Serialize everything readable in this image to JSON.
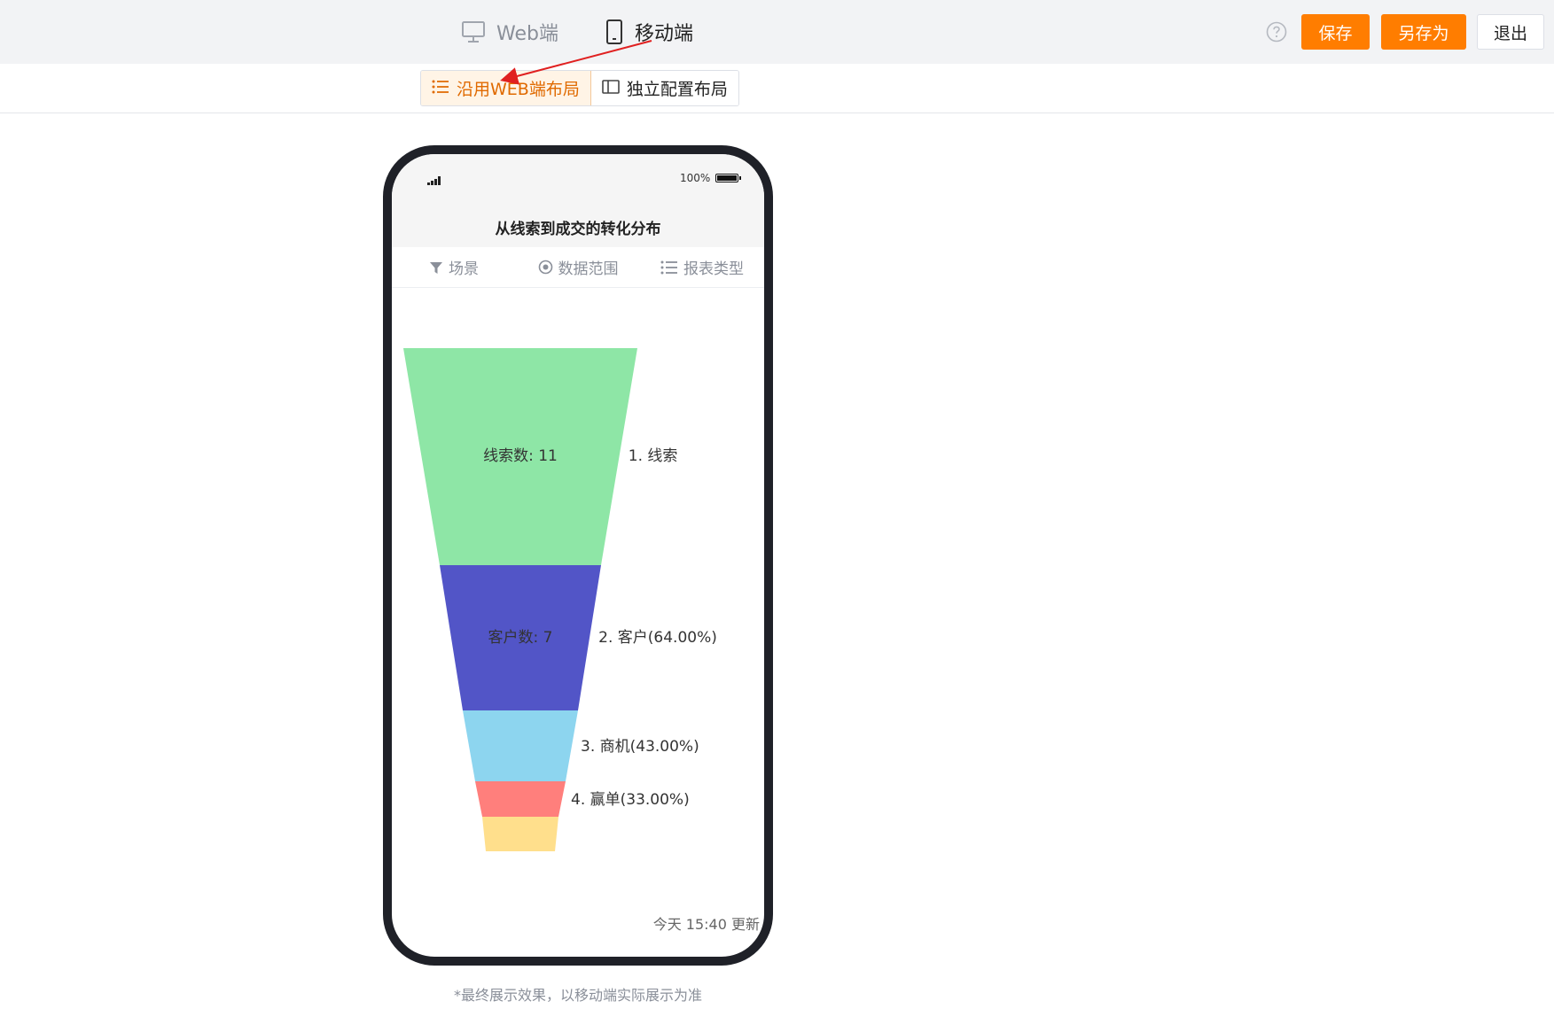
{
  "header": {
    "platform_tabs": [
      {
        "label": "Web端",
        "icon": "desktop-monitor-icon",
        "active": false
      },
      {
        "label": "移动端",
        "icon": "mobile-phone-icon",
        "active": true
      }
    ],
    "help_icon": "question-circle-icon",
    "buttons": {
      "save": "保存",
      "save_as": "另存为",
      "exit": "退出"
    },
    "accent_color": "#ff7d00"
  },
  "layout_toggle": {
    "options": [
      {
        "label": "沿用WEB端布局",
        "icon": "list-icon",
        "active": true
      },
      {
        "label": "独立配置布局",
        "icon": "panel-layout-icon",
        "active": false
      }
    ]
  },
  "phone": {
    "status": {
      "battery_percent": "100%"
    },
    "report_title": "从线索到成交的转化分布",
    "filters": [
      {
        "label": "场景",
        "icon": "filter-funnel-icon"
      },
      {
        "label": "数据范围",
        "icon": "target-circle-icon"
      },
      {
        "label": "报表类型",
        "icon": "list-icon"
      }
    ],
    "updated_text": "今天 15:40 更新"
  },
  "chart_data": {
    "type": "funnel",
    "title": "从线索到成交的转化分布",
    "stages": [
      {
        "name": "线索",
        "value": 11,
        "inside_label": "线索数: 11",
        "side_label": "1. 线索",
        "color": "#8ee6a6"
      },
      {
        "name": "客户",
        "value": 7,
        "percent": 64.0,
        "inside_label": "客户数: 7",
        "side_label": "2. 客户(64.00%)",
        "color": "#5255c7"
      },
      {
        "name": "商机",
        "percent": 43.0,
        "inside_label": "",
        "side_label": "3. 商机(43.00%)",
        "color": "#8dd5ef"
      },
      {
        "name": "赢单",
        "percent": 33.0,
        "inside_label": "",
        "side_label": "4. 赢单(33.00%)",
        "color": "#ff7f7c"
      },
      {
        "name": "",
        "inside_label": "",
        "side_label": "",
        "color": "#ffdf8c"
      }
    ]
  },
  "footnote": "*最终展示效果，以移动端实际展示为准"
}
